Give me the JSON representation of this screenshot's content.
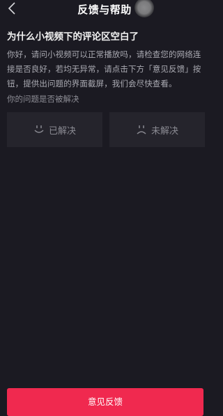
{
  "header": {
    "title": "反馈与帮助"
  },
  "article": {
    "question": "为什么小视频下的评论区空白了",
    "answer": "你好，请问小视频可以正常播放吗，请检查您的网络连接是否良好，若均无异常，请点击下方「意见反馈」按钮，提供出问题的界面截屏，我们会尽快查看。"
  },
  "resolution": {
    "prompt": "你的问题是否被解决",
    "resolved_label": "已解决",
    "unresolved_label": "未解决"
  },
  "footer": {
    "feedback_button_label": "意见反馈"
  }
}
